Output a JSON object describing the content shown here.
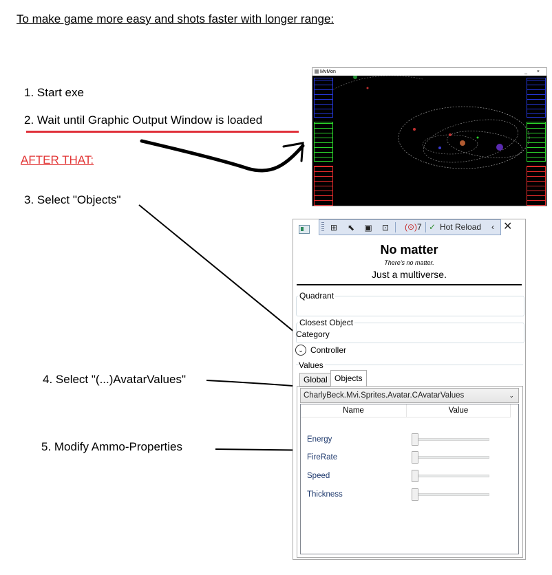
{
  "page": {
    "title": "To make game more easy and shots faster with longer range:",
    "steps": [
      "1. Start exe",
      "2. Wait until Graphic Output Window is loaded",
      "3. Select \"Objects\"",
      "4. Select \"(...)AvatarValues\"",
      "5. Modify Ammo-Properties"
    ],
    "after_label": "AFTER THAT:"
  },
  "game_window": {
    "title": "MvMon"
  },
  "panel": {
    "toolbar": {
      "error_count": "7",
      "hot_reload": "Hot Reload"
    },
    "header_title": "No matter",
    "header_subtitle": "There's no matter.",
    "header_tagline": "Just a multiverse.",
    "quadrant_label": "Quadrant",
    "closest_object_label": "Closest Object",
    "category_label": "Category",
    "controller_label": "Controller",
    "values_label": "Values",
    "tabs": [
      "Global",
      "Objects"
    ],
    "selected_tab": "Objects",
    "combo_value": "CharlyBeck.Mvi.Sprites.Avatar.CAvatarValues",
    "columns": [
      "Name",
      "Value"
    ],
    "properties": [
      {
        "name": "Energy",
        "value": 0
      },
      {
        "name": "FireRate",
        "value": 0
      },
      {
        "name": "Speed",
        "value": 0
      },
      {
        "name": "Thickness",
        "value": 0
      }
    ]
  },
  "colors": {
    "accent_red": "#e23434",
    "toolbar_bg": "#dde5f2",
    "game_bg": "#000000"
  }
}
